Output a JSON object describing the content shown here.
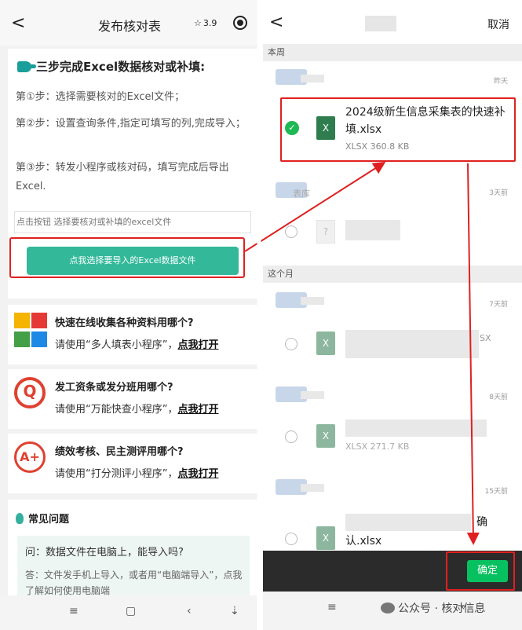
{
  "left": {
    "nav": {
      "back_glyph": "<",
      "title": "发布核对表",
      "rating": "3.9"
    },
    "steps": {
      "title": "三步完成Excel数据核对或补填:",
      "step1": "第①步：选择需要核对的Excel文件；",
      "step2": "第②步：设置查询条件,指定可填写的列,完成导入；",
      "step3": "第③步：转发小程序或核对码，填写完成后导出Excel.",
      "file_hint": "点击按钮 选择要核对或补填的excel文件",
      "select_button": "点我选择要导入的Excel数据文件"
    },
    "promos": [
      {
        "title": "快速在线收集各种资料用哪个?",
        "prefix": "请使用“多人填表小程序”，",
        "link": "点我打开"
      },
      {
        "title": "发工资条或发分班用哪个?",
        "prefix": "请使用“万能快查小程序”，",
        "link": "点我打开"
      },
      {
        "title": "绩效考核、民主测评用哪个?",
        "prefix": "请使用“打分测评小程序”，",
        "link": "点我打开"
      }
    ],
    "aplus_text": "A+",
    "faq": {
      "title": "常见问题",
      "question": "问：数据文件在电脑上，能导入吗?",
      "answer": "答：文件发手机上导入，或者用“电脑端导入”，点我了解如何使用电脑端"
    },
    "system_bar": {
      "menu": "≡",
      "home": "▢",
      "back": "‹",
      "extra": "⇣"
    }
  },
  "right": {
    "nav": {
      "back_glyph": "<",
      "cancel": "取消"
    },
    "section_this_week": "本周",
    "section_this_month": "这个月",
    "dates": [
      "昨天",
      "3天前",
      "7天前",
      "8天前",
      "15天前"
    ],
    "selected_file": {
      "name": "2024级新生信息采集表的快速补填.xlsx",
      "meta": "XLSX 360.8 KB"
    },
    "partial_texts": {
      "sender_tail": "表库",
      "row_xlsx_tail": "SX",
      "row_meta": "XLSX 271.7 KB",
      "row_last_tail": "确",
      "row_last_name_end": "认.xlsx"
    },
    "confirm_button": "确定",
    "watermark": "公众号 · 核对信息",
    "system_bar": {
      "menu": "≡",
      "home": "▢",
      "back": "‹"
    }
  },
  "colors": {
    "accent_green": "#33b89a",
    "wechat_green": "#07c160",
    "highlight_red": "#e02020",
    "excel_green": "#2f7d4f"
  },
  "icons": [
    "hand-point-icon",
    "star-icon",
    "target-icon",
    "grid-apps-icon",
    "seal-icon",
    "a-plus-icon",
    "bulb-icon",
    "check-icon",
    "xlsx-file-icon"
  ]
}
